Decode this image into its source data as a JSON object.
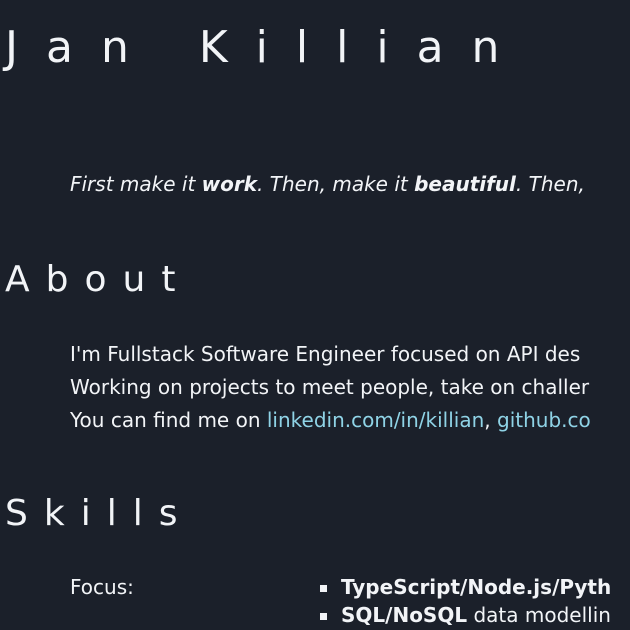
{
  "header": {
    "name": "Jan Killian"
  },
  "quote": {
    "part1": "First make it ",
    "bold1": "work",
    "part2": ". Then, make it ",
    "bold2": "beautiful",
    "part3": ". Then,"
  },
  "about": {
    "title": "About",
    "line1": "I'm Fullstack Software Engineer focused on API des",
    "line2": "Working on projects to meet people, take on challer",
    "line3_prefix": "You can find me on ",
    "linkedin_label": "linkedin.com/in/killian",
    "separator": ", ",
    "github_label": "github.co"
  },
  "skills": {
    "title": "Skills",
    "focus_label": "Focus:",
    "focus_items": [
      {
        "bold": "TypeScript/Node.js/Pyth",
        "rest": ""
      },
      {
        "bold": "SQL/NoSQL",
        "rest": " data modellin"
      }
    ]
  },
  "colors": {
    "background": "#1b202a",
    "text": "#f2f4f7",
    "link": "#8fd3e6"
  }
}
